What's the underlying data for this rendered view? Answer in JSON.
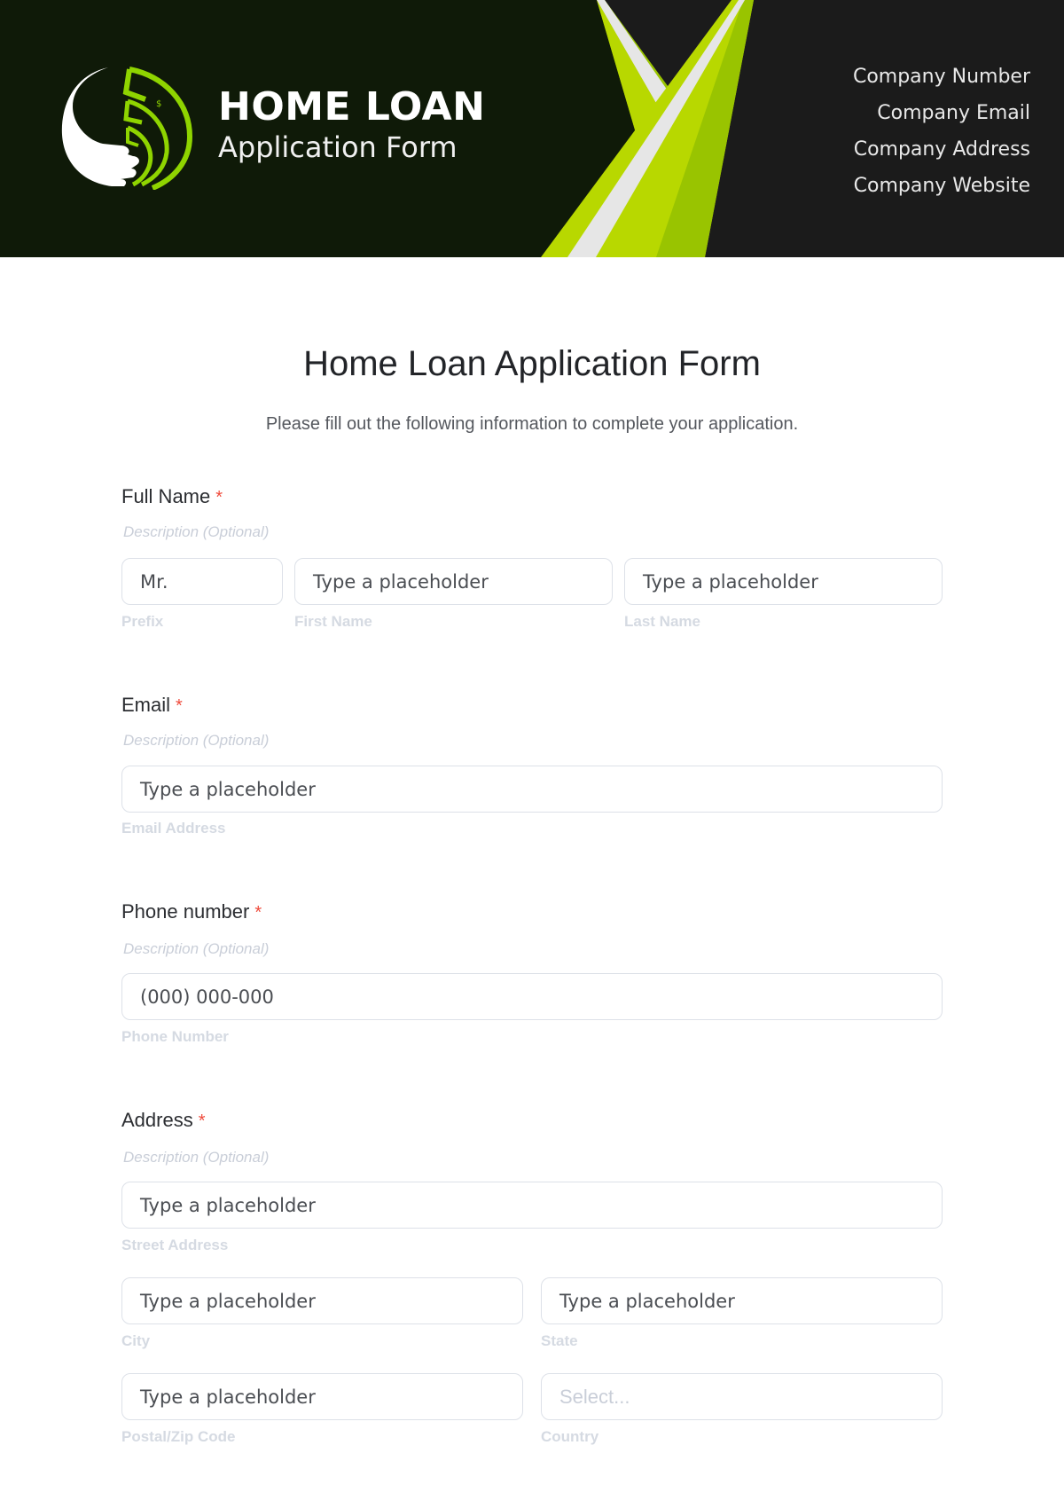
{
  "header": {
    "brand_title": "HOME LOAN",
    "brand_subtitle": "Application Form",
    "company_info": [
      "Company Number",
      "Company Email",
      "Company Address",
      "Company Website"
    ],
    "colors": {
      "left_bg": "#0f1a08",
      "right_bg": "#1b1b1b",
      "accent_green": "#b8d800",
      "accent_dark_green": "#99c400",
      "accent_white": "#e6e6e6"
    }
  },
  "form": {
    "title": "Home Loan Application Form",
    "subtitle": "Please fill out the following information to complete your application.",
    "required_marker": "*",
    "fields": {
      "full_name": {
        "label": "Full Name",
        "description": "Description (Optional)",
        "prefix": {
          "value": "Mr.",
          "sublabel": "Prefix"
        },
        "first_name": {
          "placeholder": "Type a placeholder",
          "sublabel": "First Name"
        },
        "last_name": {
          "placeholder": "Type a placeholder",
          "sublabel": "Last Name"
        }
      },
      "email": {
        "label": "Email",
        "description": "Description (Optional)",
        "placeholder": "Type a placeholder",
        "sublabel": "Email Address"
      },
      "phone": {
        "label": "Phone number",
        "description": "Description (Optional)",
        "placeholder": "(000) 000-000",
        "sublabel": "Phone Number"
      },
      "address": {
        "label": "Address",
        "description": "Description (Optional)",
        "street": {
          "placeholder": "Type a placeholder",
          "sublabel": "Street Address"
        },
        "city": {
          "placeholder": "Type a placeholder",
          "sublabel": "City"
        },
        "state": {
          "placeholder": "Type a placeholder",
          "sublabel": "State"
        },
        "postal": {
          "placeholder": "Type a placeholder",
          "sublabel": "Postal/Zip Code"
        },
        "country": {
          "placeholder": "Select...",
          "sublabel": "Country"
        }
      }
    },
    "colors": {
      "required": "#ef4b3c",
      "input_border": "#dde1e8",
      "muted_text": "#c9ced8"
    }
  }
}
